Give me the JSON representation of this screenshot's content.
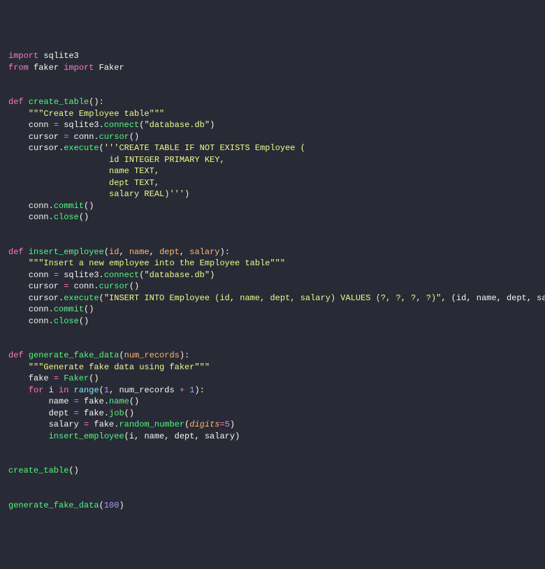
{
  "code": {
    "l1_import": "import",
    "l1_module": " sqlite3",
    "l2_from": "from",
    "l2_module": " faker ",
    "l2_import": "import",
    "l2_name": " Faker",
    "l5_def": "def",
    "l5_name": " create_table",
    "l5_rest": "():",
    "l6_doc": "    \"\"\"Create Employee table\"\"\"",
    "l7_conn": "    conn ",
    "l7_eq": "=",
    "l7_mod": " sqlite3.",
    "l7_fn": "connect",
    "l7_p": "(",
    "l7_s": "\"database.db\"",
    "l7_cp": ")",
    "l8_cur": "    cursor ",
    "l8_eq": "=",
    "l8_obj": " conn.",
    "l8_fn": "cursor",
    "l8_p": "()",
    "l9_cur": "    cursor.",
    "l9_fn": "execute",
    "l9_p": "(",
    "l9_s": "'''CREATE TABLE IF NOT EXISTS Employee (",
    "l10_s": "                    id INTEGER PRIMARY KEY,",
    "l11_s": "                    name TEXT,",
    "l12_s": "                    dept TEXT,",
    "l13_s": "                    salary REAL)'''",
    "l13_cp": ")",
    "l14_obj": "    conn.",
    "l14_fn": "commit",
    "l14_p": "()",
    "l15_obj": "    conn.",
    "l15_fn": "close",
    "l15_p": "()",
    "l18_def": "def",
    "l18_name": " insert_employee",
    "l18_p": "(",
    "l18_p1": "id",
    "l18_c1": ", ",
    "l18_p2": "name",
    "l18_c2": ", ",
    "l18_p3": "dept",
    "l18_c3": ", ",
    "l18_p4": "salary",
    "l18_cp": "):",
    "l19_doc": "    \"\"\"Insert a new employee into the Employee table\"\"\"",
    "l20_conn": "    conn ",
    "l20_eq": "=",
    "l20_mod": " sqlite3.",
    "l20_fn": "connect",
    "l20_p": "(",
    "l20_s": "\"database.db\"",
    "l20_cp": ")",
    "l21_cur": "    cursor ",
    "l21_eq": "=",
    "l21_obj": " conn.",
    "l21_fn": "cursor",
    "l21_p": "()",
    "l22_cur": "    cursor.",
    "l22_fn": "execute",
    "l22_p": "(",
    "l22_s": "\"INSERT INTO Employee (id, name, dept, salary) VALUES (?, ?, ?, ?)\"",
    "l22_rest": ", (id, name, dept, salary))",
    "l23_obj": "    conn.",
    "l23_fn": "commit",
    "l23_p": "()",
    "l24_obj": "    conn.",
    "l24_fn": "close",
    "l24_p": "()",
    "l27_def": "def",
    "l27_name": " generate_fake_data",
    "l27_p": "(",
    "l27_p1": "num_records",
    "l27_cp": "):",
    "l28_doc": "    \"\"\"Generate fake data using faker\"\"\"",
    "l29_fake": "    fake ",
    "l29_eq": "=",
    "l29_fn": " Faker",
    "l29_p": "()",
    "l30_ind": "    ",
    "l30_for": "for",
    "l30_sp1": " i ",
    "l30_in": "in",
    "l30_sp2": " ",
    "l30_range": "range",
    "l30_p": "(",
    "l30_n1": "1",
    "l30_c": ", num_records ",
    "l30_plus": "+",
    "l30_sp3": " ",
    "l30_n2": "1",
    "l30_cp": "):",
    "l31_name": "        name ",
    "l31_eq": "=",
    "l31_obj": " fake.",
    "l31_fn": "name",
    "l31_p": "()",
    "l32_dept": "        dept ",
    "l32_eq": "=",
    "l32_obj": " fake.",
    "l32_fn": "job",
    "l32_p": "()",
    "l33_sal": "        salary ",
    "l33_eq": "=",
    "l33_obj": " fake.",
    "l33_fn": "random_number",
    "l33_p": "(",
    "l33_kw": "digits",
    "l33_eq2": "=",
    "l33_n": "5",
    "l33_cp": ")",
    "l34_ind": "        ",
    "l34_fn": "insert_employee",
    "l34_p": "(i, name, dept, salary)",
    "l37_fn": "create_table",
    "l37_p": "()",
    "l40_fn": "generate_fake_data",
    "l40_p": "(",
    "l40_n": "100",
    "l40_cp": ")"
  }
}
